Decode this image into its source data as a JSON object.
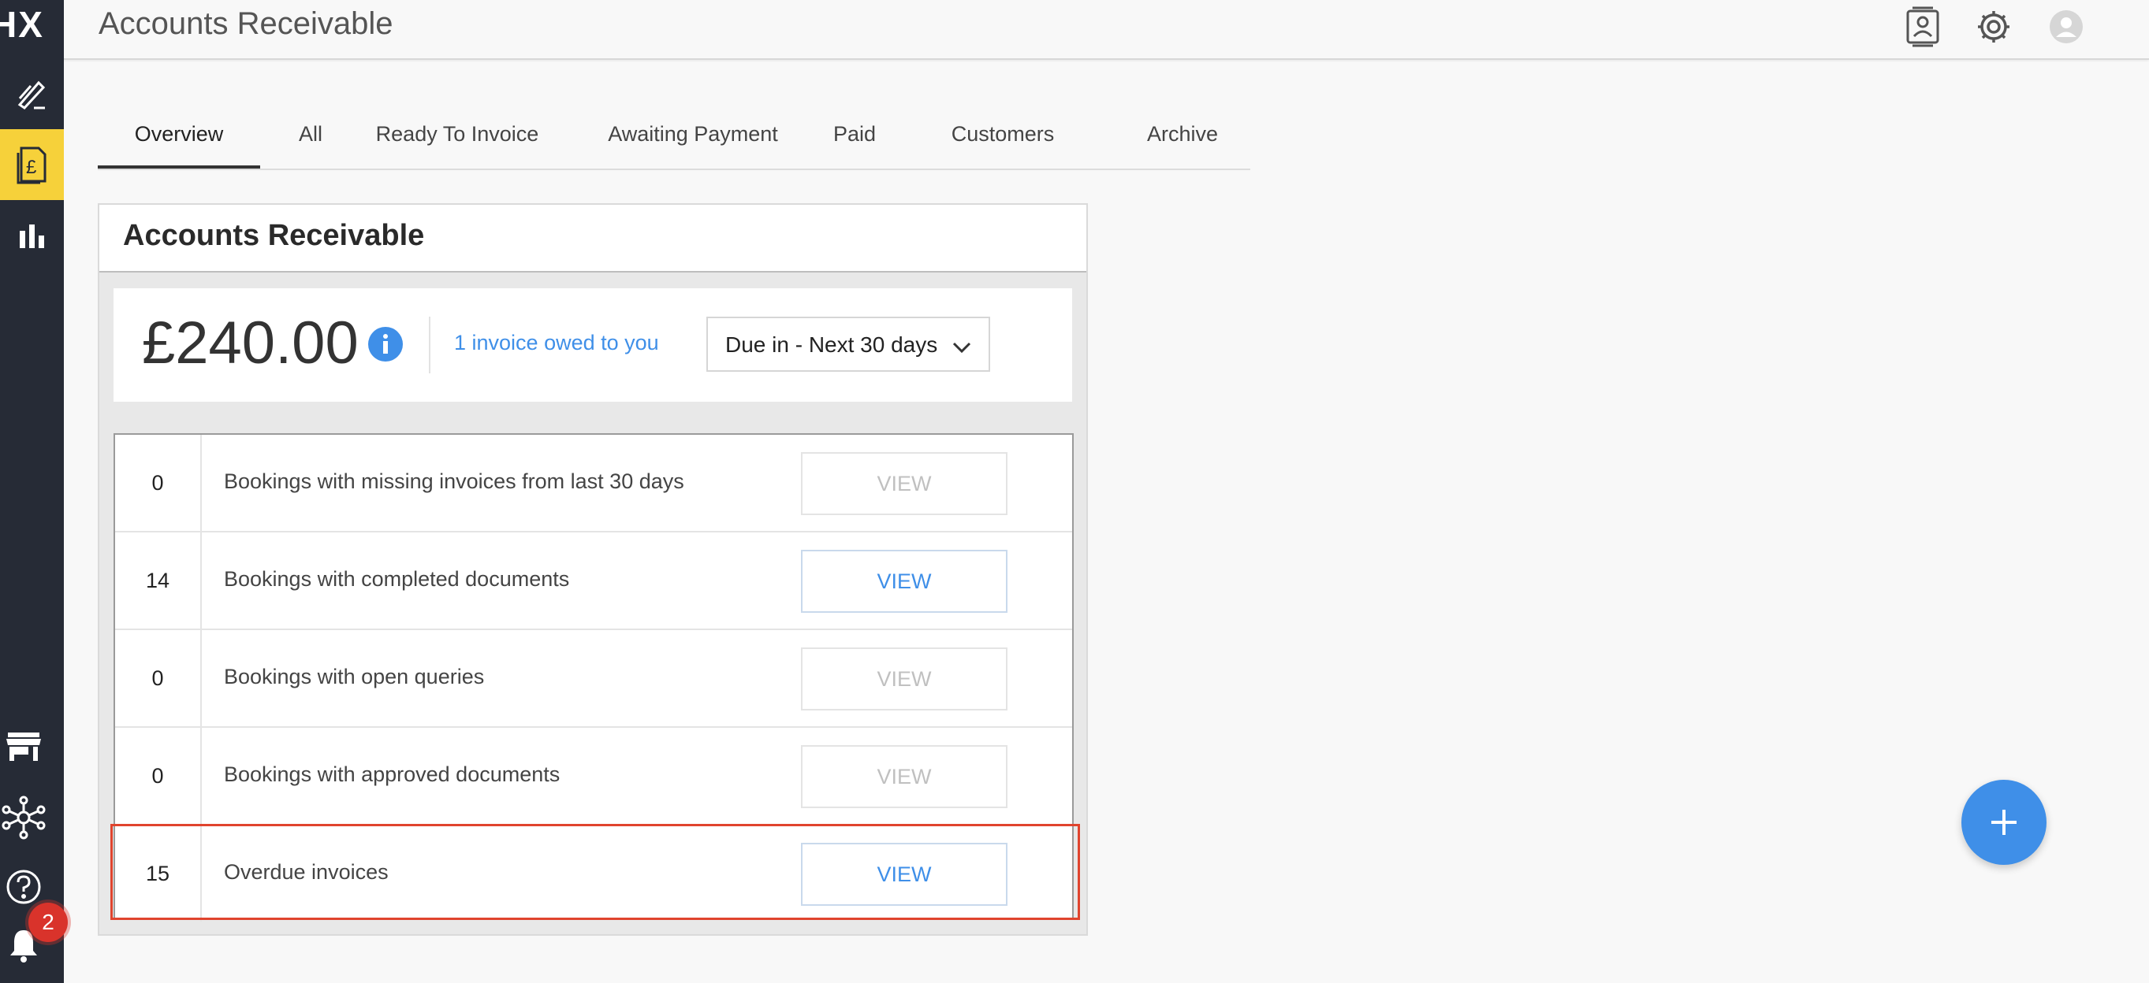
{
  "header": {
    "title": "Accounts Receivable"
  },
  "sidebar": {
    "logo_text": "HX",
    "notification_count": "2"
  },
  "tabs": [
    {
      "label": "Overview",
      "active": true
    },
    {
      "label": "All"
    },
    {
      "label": "Ready To Invoice"
    },
    {
      "label": "Awaiting Payment"
    },
    {
      "label": "Paid"
    },
    {
      "label": "Customers"
    },
    {
      "label": "Archive"
    }
  ],
  "card": {
    "title": "Accounts Receivable",
    "amount": "£240.00",
    "owed_link": "1 invoice owed to you",
    "due_filter": "Due in - Next 30 days",
    "rows": [
      {
        "count": "0",
        "label": "Bookings with missing invoices from last 30 days",
        "button": "VIEW",
        "enabled": false
      },
      {
        "count": "14",
        "label": "Bookings with completed documents",
        "button": "VIEW",
        "enabled": true
      },
      {
        "count": "0",
        "label": "Bookings with open queries",
        "button": "VIEW",
        "enabled": false
      },
      {
        "count": "0",
        "label": "Bookings with approved documents",
        "button": "VIEW",
        "enabled": false
      },
      {
        "count": "15",
        "label": "Overdue invoices",
        "button": "VIEW",
        "enabled": true
      }
    ]
  },
  "colors": {
    "sidebar_bg": "#262b36",
    "active_nav": "#f6d13a",
    "accent_blue": "#3f8fe8",
    "badge_red": "#d9332b",
    "highlight_red": "#e0442e"
  }
}
